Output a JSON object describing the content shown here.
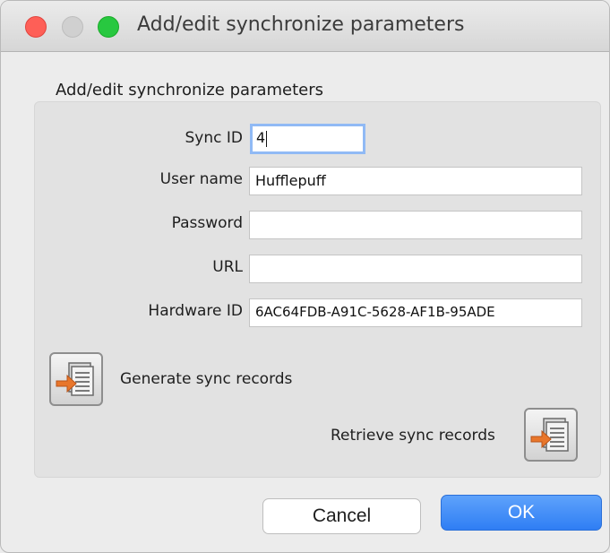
{
  "window": {
    "title": "Add/edit synchronize parameters"
  },
  "group": {
    "title": "Add/edit synchronize parameters"
  },
  "fields": {
    "sync_id": {
      "label": "Sync ID",
      "value": "4"
    },
    "user_name": {
      "label": "User name",
      "value": "Hufflepuff"
    },
    "password": {
      "label": "Password",
      "value": ""
    },
    "url": {
      "label": "URL",
      "value": ""
    },
    "hardware_id": {
      "label": "Hardware ID",
      "value": "6AC64FDB-A91C-5628-AF1B-95ADE"
    }
  },
  "actions": {
    "generate_label": "Generate sync records",
    "retrieve_label": "Retrieve sync records",
    "icon": "import-document-icon"
  },
  "buttons": {
    "cancel_label": "Cancel",
    "ok_label": "OK"
  },
  "colors": {
    "ok_button": "#2f7ef4",
    "focus_ring": "#90baf5",
    "arrow": "#e8762b"
  }
}
